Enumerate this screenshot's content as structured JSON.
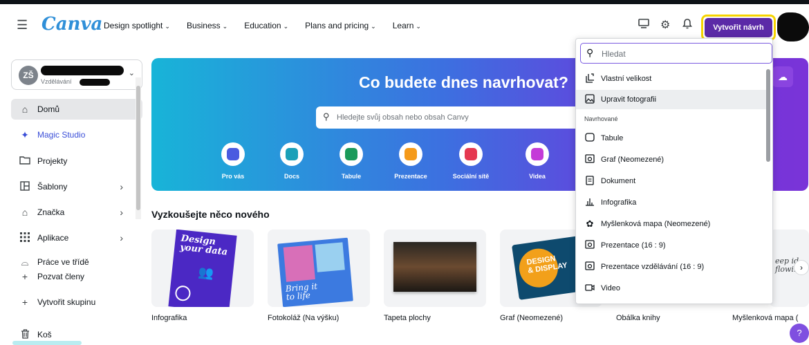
{
  "header": {
    "logo": "Canva",
    "nav": [
      {
        "label": "Design spotlight"
      },
      {
        "label": "Business"
      },
      {
        "label": "Education"
      },
      {
        "label": "Plans and pricing"
      },
      {
        "label": "Learn"
      }
    ],
    "create_button": "Vytvořit návrh"
  },
  "sidebar": {
    "team_initials": "ZŠ",
    "team_subtitle": "Vzdělávání",
    "items": [
      {
        "label": "Domů",
        "icon": "home-icon"
      },
      {
        "label": "Magic Studio",
        "icon": "sparkle-icon"
      },
      {
        "label": "Projekty",
        "icon": "folder-icon"
      },
      {
        "label": "Šablony",
        "icon": "template-icon"
      },
      {
        "label": "Značka",
        "icon": "brand-icon"
      },
      {
        "label": "Aplikace",
        "icon": "apps-icon"
      },
      {
        "label": "Práce ve třídě",
        "icon": "classwork-icon"
      },
      {
        "label": "Pozvat členy",
        "icon": "plus-icon"
      },
      {
        "label": "Vytvořit skupinu",
        "icon": "plus-icon"
      },
      {
        "label": "Koš",
        "icon": "trash-icon"
      }
    ]
  },
  "hero": {
    "title": "Co budete dnes navrhovat?",
    "search_placeholder": "Hledejte svůj obsah nebo obsah Canvy",
    "categories": [
      {
        "label": "Pro vás",
        "color": "#4a5be0"
      },
      {
        "label": "Docs",
        "color": "#1aa0b8"
      },
      {
        "label": "Tabule",
        "color": "#1a9a5a"
      },
      {
        "label": "Prezentace",
        "color": "#f59a1a"
      },
      {
        "label": "Sociální sítě",
        "color": "#e53850"
      },
      {
        "label": "Videa",
        "color": "#c43bd8"
      }
    ]
  },
  "try_new": {
    "title": "Vyzkoušejte něco nového",
    "cards": [
      {
        "label": "Infografika",
        "art_line1": "Design",
        "art_line2": "your data"
      },
      {
        "label": "Fotokoláž (Na výšku)",
        "art_line1": "Bring it",
        "art_line2": "to life"
      },
      {
        "label": "Tapeta plochy"
      },
      {
        "label": "Graf (Neomezené)",
        "art_line1": "DESIGN",
        "art_line2": "& DISPLAY"
      },
      {
        "label": "Obálka knihy"
      },
      {
        "label": "Myšlenková mapa (",
        "art_line1": "eep id",
        "art_line2": "flowin"
      }
    ]
  },
  "dropdown": {
    "search_placeholder": "Hledat",
    "top_items": [
      {
        "label": "Vlastní velikost",
        "icon": "custom-size-icon"
      },
      {
        "label": "Upravit fotografii",
        "icon": "edit-photo-icon"
      }
    ],
    "heading": "Navrhované",
    "suggested": [
      {
        "label": "Tabule",
        "icon": "whiteboard-icon"
      },
      {
        "label": "Graf (Neomezené)",
        "icon": "graph-icon"
      },
      {
        "label": "Dokument",
        "icon": "document-icon"
      },
      {
        "label": "Infografika",
        "icon": "infographic-icon"
      },
      {
        "label": "Myšlenková mapa (Neomezené)",
        "icon": "mindmap-icon"
      },
      {
        "label": "Prezentace (16 : 9)",
        "icon": "presentation-icon"
      },
      {
        "label": "Prezentace vzdělávání (16 : 9)",
        "icon": "presentation-icon"
      },
      {
        "label": "Video",
        "icon": "video-icon"
      }
    ]
  },
  "colors": {
    "brand": "#5b2aa7",
    "highlight": "#f6d400",
    "logo": "#2f8fd8"
  }
}
